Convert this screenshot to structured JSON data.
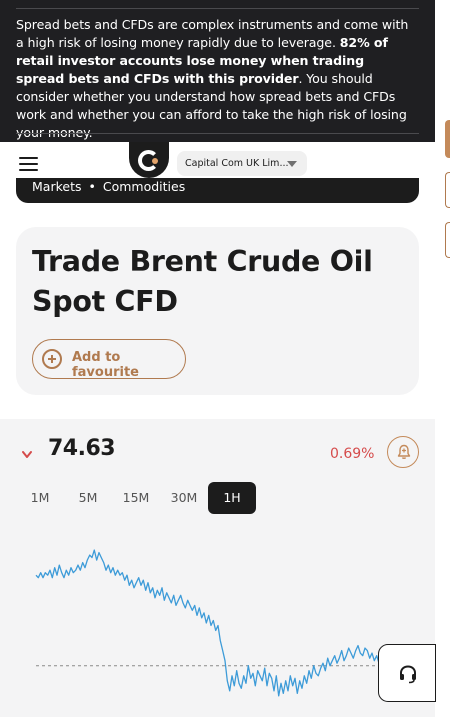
{
  "risk_banner": {
    "text_pre": "Spread bets and CFDs are complex instruments and come with a high risk of losing money rapidly due to leverage. ",
    "text_bold": "82% of retail investor accounts lose money when trading spread bets and CFDs with this provider",
    "text_post": ". You should consider whether you understand how spread bets and CFDs work and whether you can afford to take the high risk of losing your money."
  },
  "header": {
    "menu_icon": "hamburger-icon",
    "logo_icon": "capital-com-logo",
    "entity_label": "Capital Com UK Lim..."
  },
  "breadcrumb": {
    "items": [
      "Markets",
      "Commodities"
    ],
    "separator": "•"
  },
  "instrument": {
    "title": "Trade Brent Crude Oil Spot CFD",
    "favourite_label": "Add to favourite"
  },
  "quote": {
    "price": "74.63",
    "change": "0.69%",
    "direction": "down",
    "alert_icon": "bell-icon"
  },
  "timeframes": {
    "options": [
      "1M",
      "5M",
      "15M",
      "30M",
      "1H"
    ],
    "selected": "1H"
  },
  "chart_data": {
    "type": "line",
    "values": [
      56,
      55,
      57,
      55,
      57,
      56,
      58,
      55,
      59,
      56,
      60,
      57,
      55,
      58,
      56,
      59,
      57,
      58,
      60,
      58,
      61,
      59,
      62,
      64,
      63,
      66,
      62,
      65,
      63,
      61,
      58,
      60,
      57,
      59,
      56,
      58,
      56,
      57,
      54,
      56,
      52,
      54,
      51,
      53,
      55,
      52,
      54,
      50,
      53,
      49,
      51,
      47,
      50,
      48,
      51,
      46,
      49,
      47,
      45,
      48,
      44,
      46,
      48,
      45,
      43,
      46,
      44,
      42,
      44,
      40,
      43,
      39,
      41,
      37,
      40,
      36,
      38,
      34,
      36,
      30,
      26,
      22,
      14,
      10,
      16,
      12,
      18,
      13,
      11,
      16,
      13,
      20,
      15,
      17,
      12,
      18,
      16,
      14,
      19,
      12,
      17,
      15,
      10,
      16,
      8,
      13,
      9,
      14,
      10,
      16,
      12,
      15,
      9,
      14,
      11,
      16,
      13,
      18,
      15,
      20,
      17,
      16,
      19,
      21,
      18,
      23,
      20,
      22,
      24,
      21,
      23,
      26,
      22,
      24,
      27,
      25,
      23,
      26,
      28,
      25,
      24,
      27,
      26,
      23,
      25,
      22,
      24,
      21,
      20,
      18,
      16,
      13,
      17,
      15,
      14,
      18,
      17
    ],
    "reference": 20,
    "ylim": [
      0,
      70
    ],
    "line_color": "#3d9bd8",
    "reference_color": "#8a8a8a",
    "grid": false
  },
  "support": {
    "icon": "headset-icon"
  },
  "colors": {
    "accent": "#b07a4f",
    "negative": "#d54b4b",
    "dark": "#1c1c1c"
  }
}
